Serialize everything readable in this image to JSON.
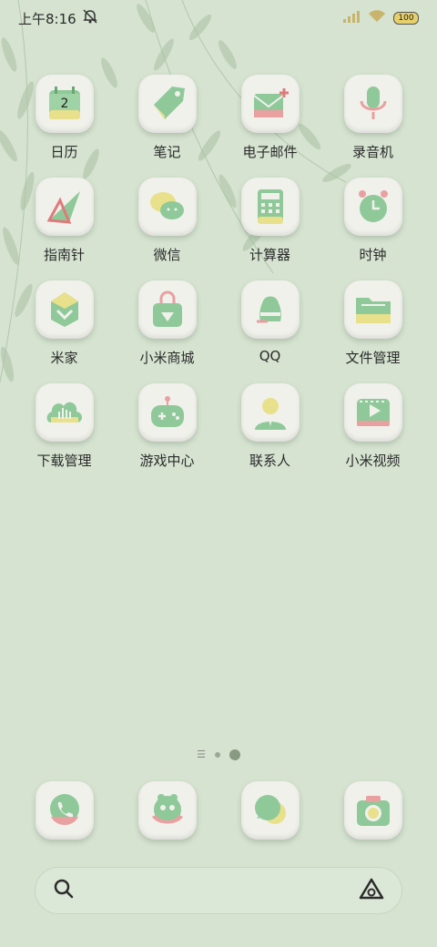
{
  "status_bar": {
    "time": "上午8:16",
    "battery": "100",
    "icons": [
      "mute-icon",
      "signal-icon",
      "wifi-icon",
      "battery-icon"
    ]
  },
  "apps": [
    {
      "label": "日历",
      "icon": "calendar-icon",
      "badge": "2"
    },
    {
      "label": "笔记",
      "icon": "notes-icon"
    },
    {
      "label": "电子邮件",
      "icon": "email-icon"
    },
    {
      "label": "录音机",
      "icon": "recorder-icon"
    },
    {
      "label": "指南针",
      "icon": "compass-icon"
    },
    {
      "label": "微信",
      "icon": "wechat-icon"
    },
    {
      "label": "计算器",
      "icon": "calculator-icon"
    },
    {
      "label": "时钟",
      "icon": "clock-icon"
    },
    {
      "label": "米家",
      "icon": "mijia-icon"
    },
    {
      "label": "小米商城",
      "icon": "mi-store-icon"
    },
    {
      "label": "QQ",
      "icon": "qq-icon"
    },
    {
      "label": "文件管理",
      "icon": "file-manager-icon"
    },
    {
      "label": "下载管理",
      "icon": "download-manager-icon"
    },
    {
      "label": "游戏中心",
      "icon": "game-center-icon"
    },
    {
      "label": "联系人",
      "icon": "contacts-icon"
    },
    {
      "label": "小米视频",
      "icon": "mi-video-icon"
    }
  ],
  "page_indicator": {
    "pages": 3,
    "active": 3
  },
  "dock": [
    {
      "icon": "phone-icon"
    },
    {
      "icon": "browser-icon"
    },
    {
      "icon": "messages-icon"
    },
    {
      "icon": "camera-icon"
    }
  ],
  "search_bar": {
    "icons": [
      "search-icon",
      "assistant-icon"
    ]
  },
  "colors": {
    "background": "#d5e3d0",
    "tile": "#f1f1ec",
    "green": "#8fc999",
    "yellow": "#e8e08a",
    "pink": "#e8a0a0"
  }
}
